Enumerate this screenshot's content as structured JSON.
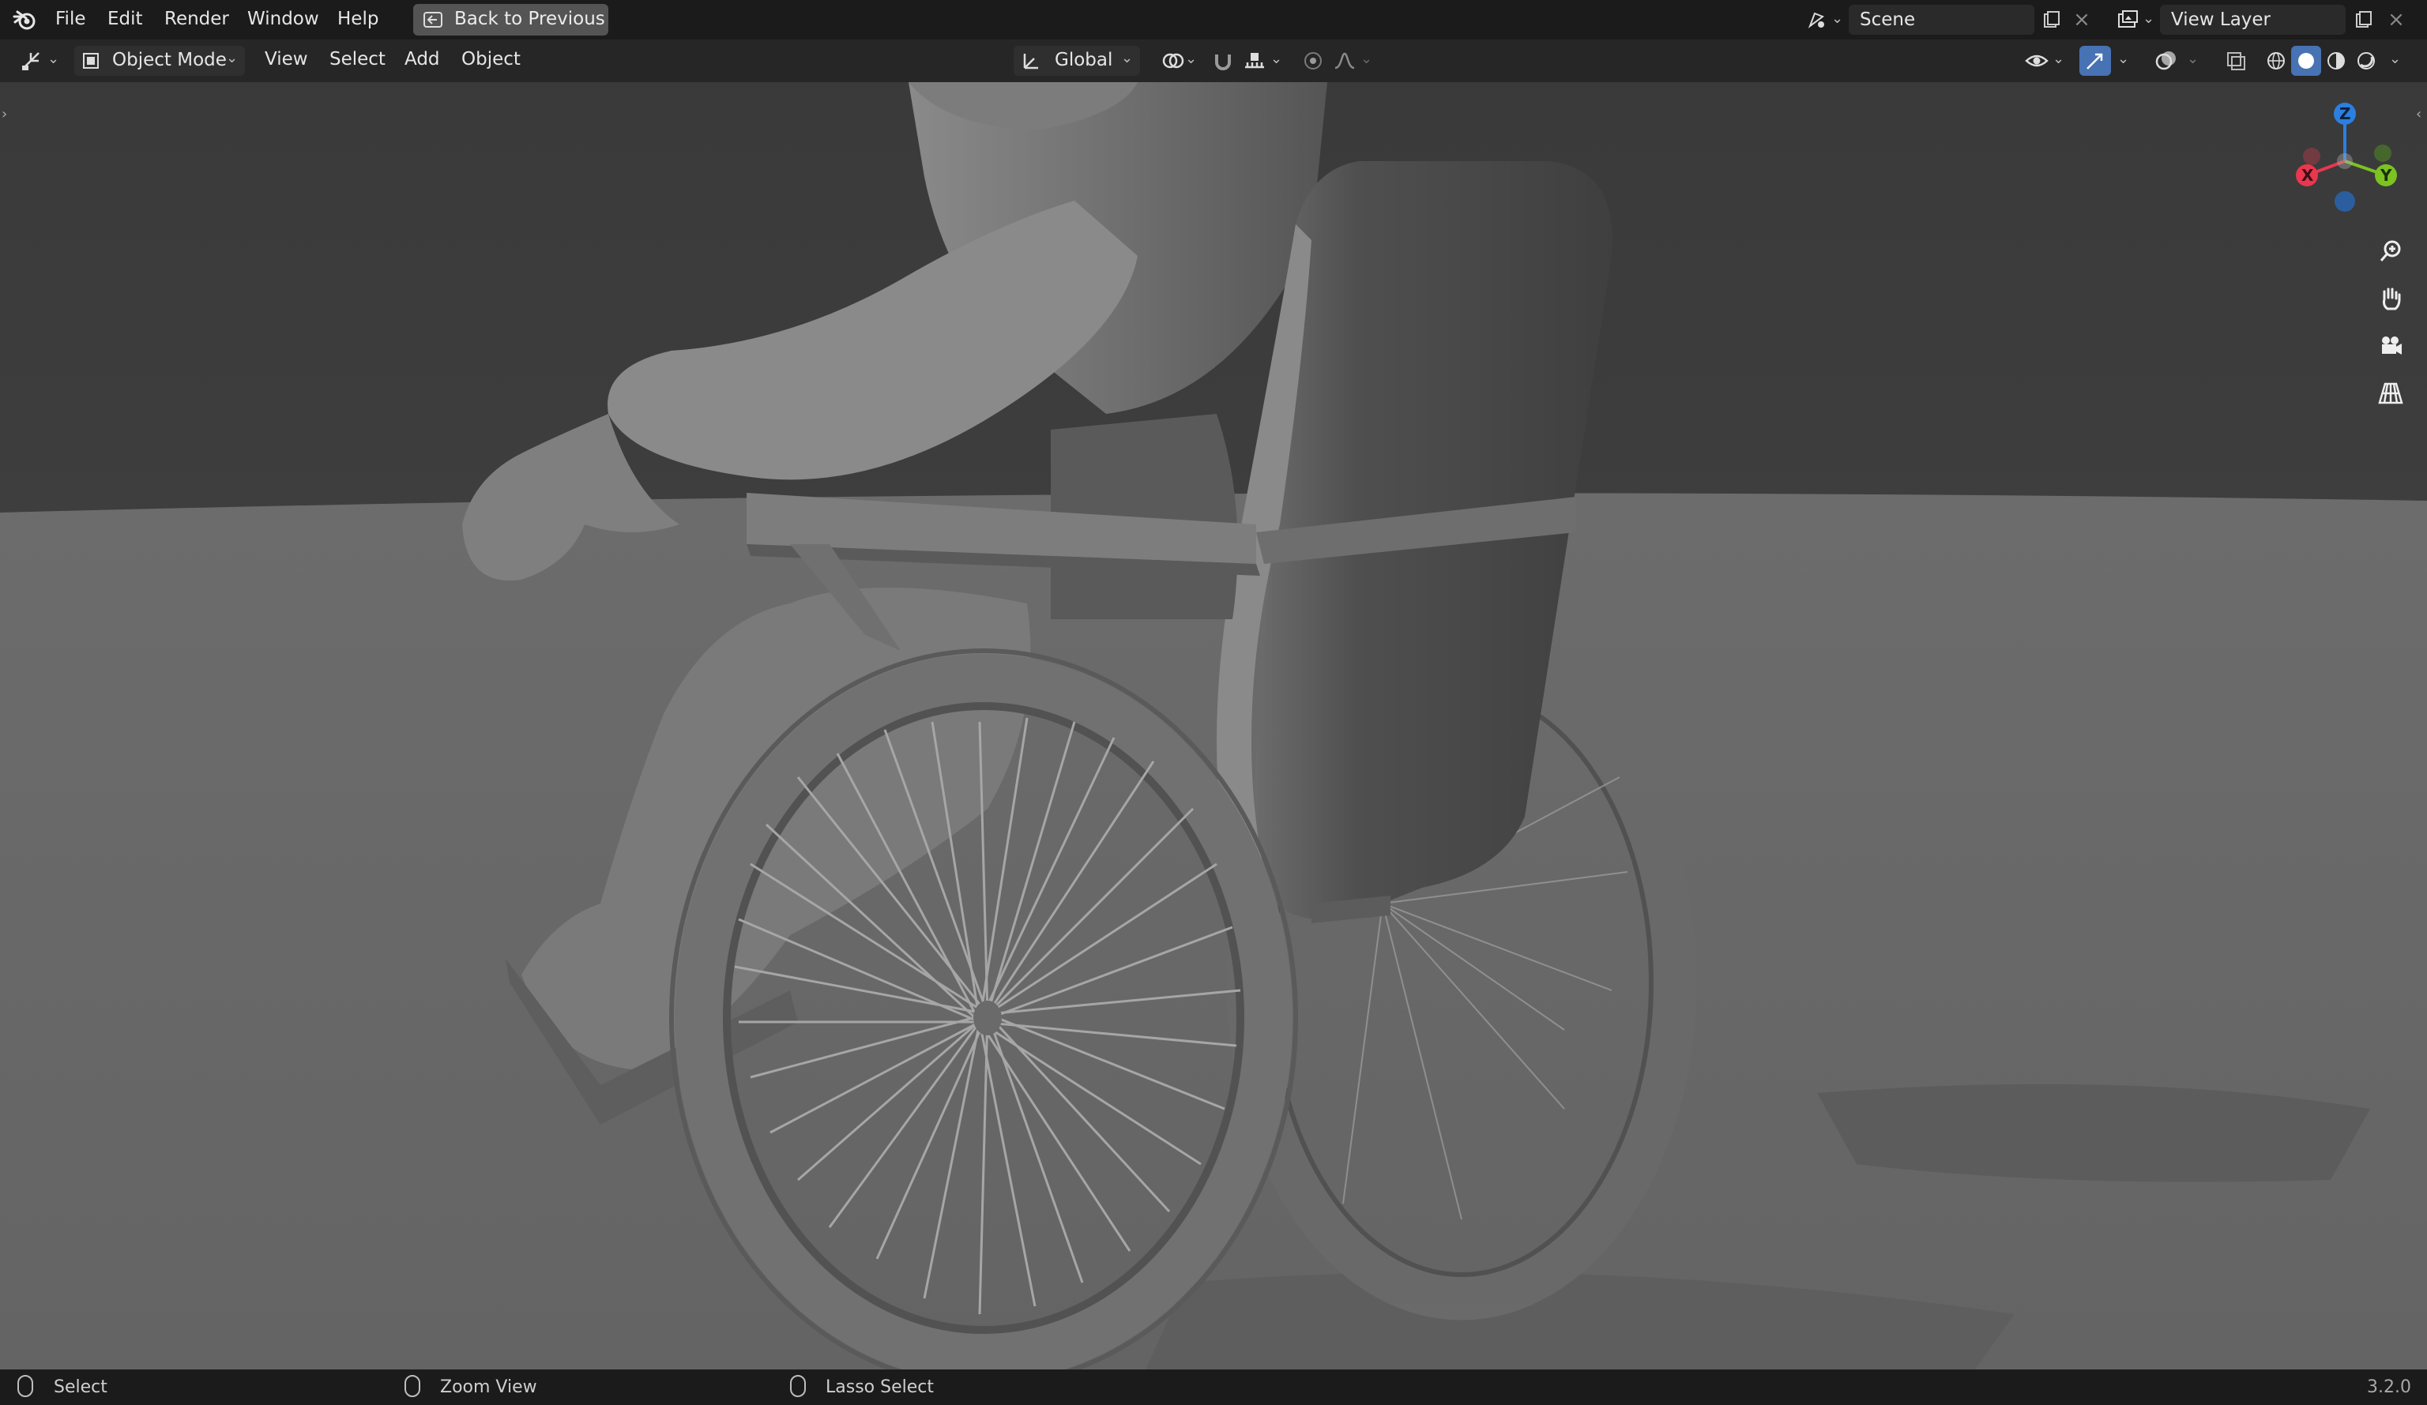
{
  "topbar": {
    "menus": [
      "File",
      "Edit",
      "Render",
      "Window",
      "Help"
    ],
    "back_button": "Back to Previous",
    "scene_name": "Scene",
    "view_layer_name": "View Layer"
  },
  "header": {
    "mode": "Object Mode",
    "menus": [
      "View",
      "Select",
      "Add",
      "Object"
    ],
    "orientation": "Global"
  },
  "gizmo": {
    "z": "Z",
    "x": "X",
    "y": "Y",
    "colors": {
      "x": "#e8374f",
      "y": "#7cc221",
      "z": "#2b7fe0"
    }
  },
  "statusbar": {
    "items": [
      "Select",
      "Zoom View",
      "Lasso Select"
    ],
    "version": "3.2.0"
  },
  "colors": {
    "accent": "#4772b3",
    "viewport_bg": "#404040",
    "floor": "#686868"
  }
}
